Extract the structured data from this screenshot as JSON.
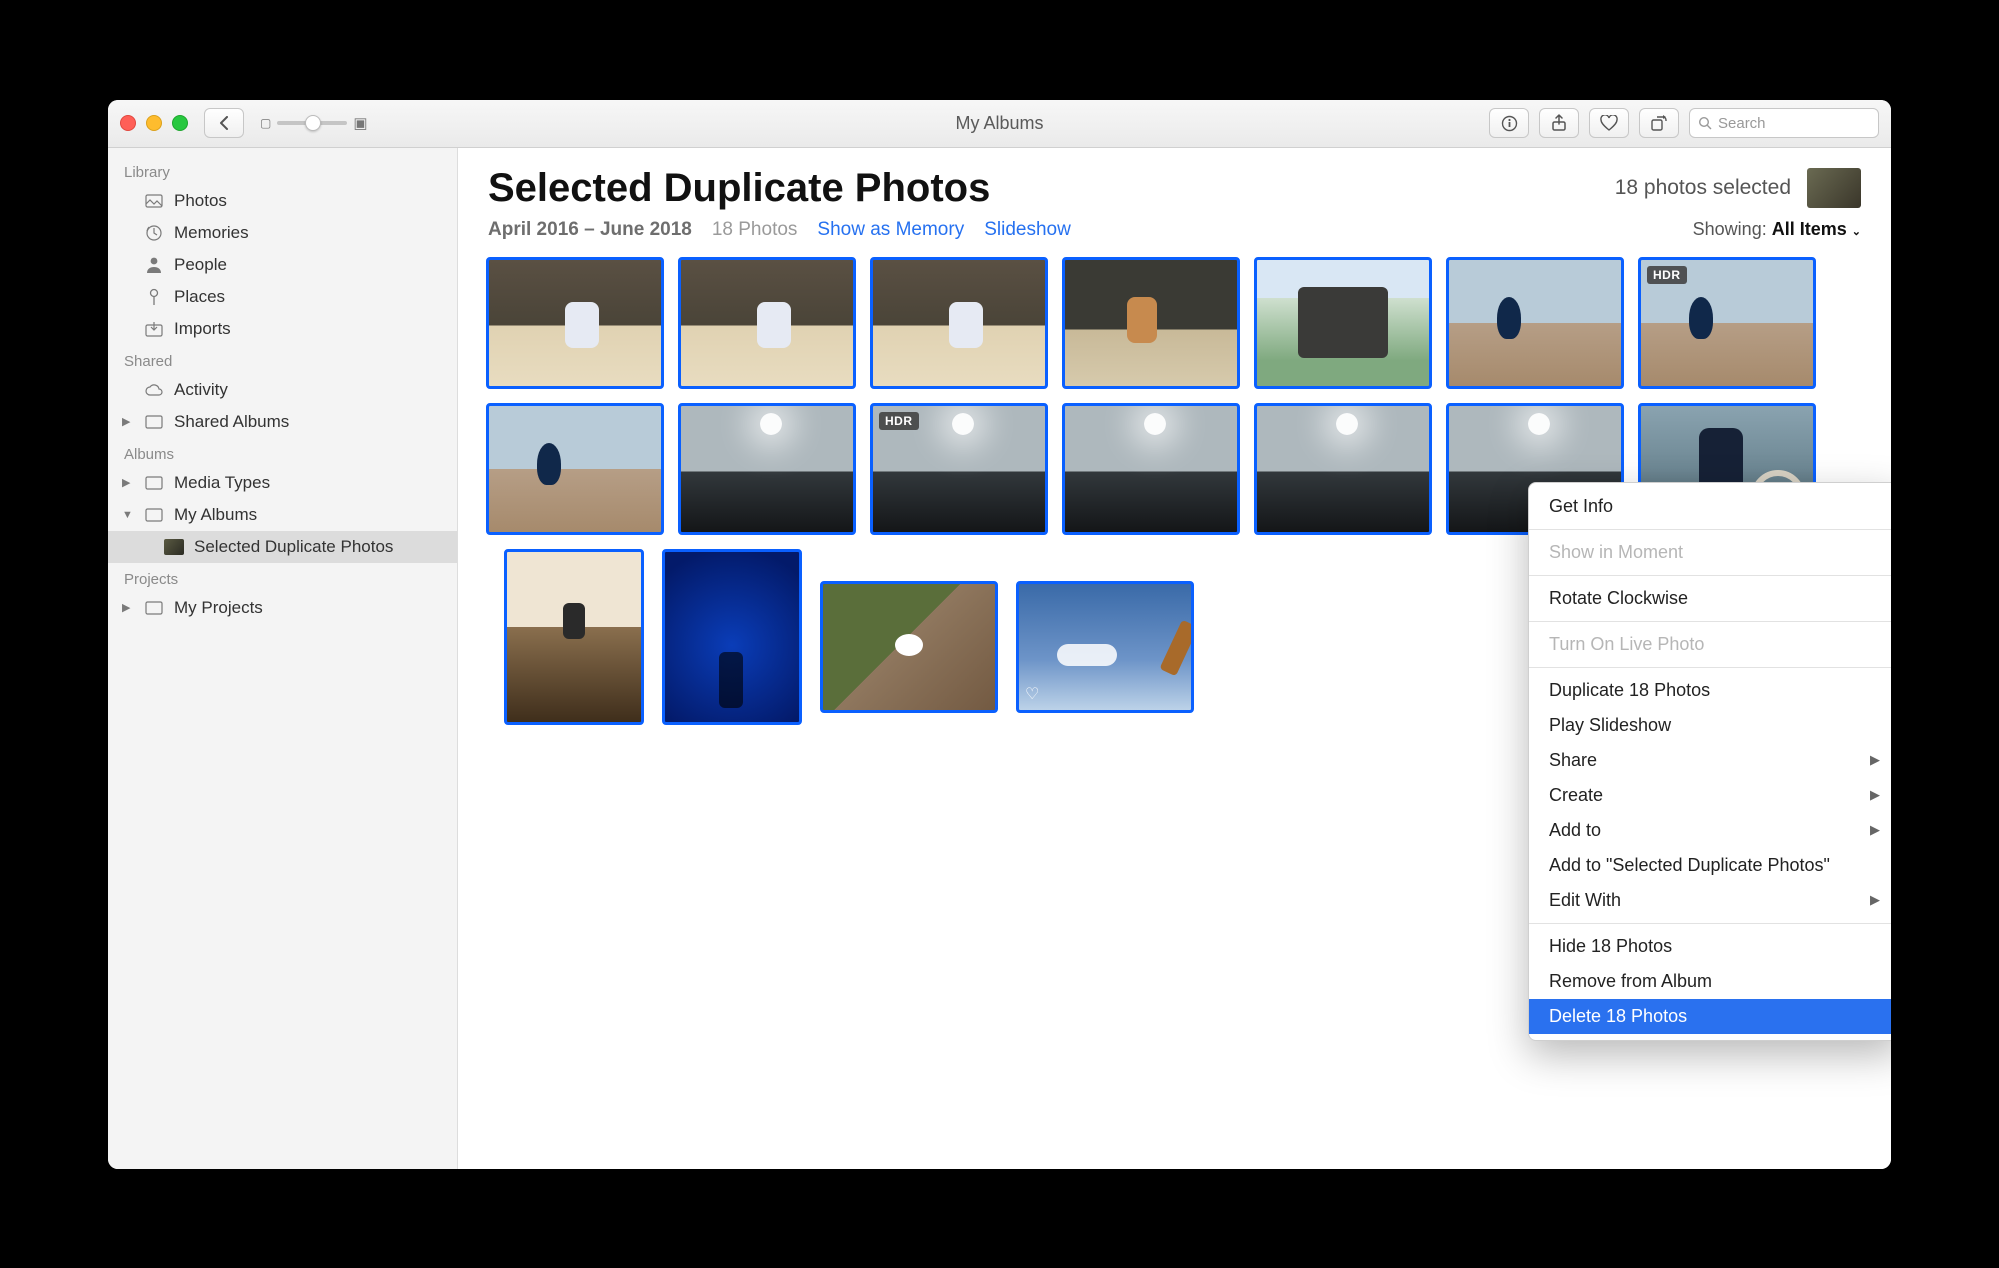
{
  "window_title": "My Albums",
  "search_placeholder": "Search",
  "sidebar": {
    "sections": {
      "library": "Library",
      "shared": "Shared",
      "albums": "Albums",
      "projects": "Projects"
    },
    "library_items": [
      "Photos",
      "Memories",
      "People",
      "Places",
      "Imports"
    ],
    "shared_items": [
      "Activity",
      "Shared Albums"
    ],
    "albums_items": [
      "Media Types",
      "My Albums"
    ],
    "my_albums_children": [
      "Selected Duplicate Photos"
    ],
    "projects_items": [
      "My Projects"
    ]
  },
  "header": {
    "title": "Selected Duplicate Photos",
    "selection": "18 photos selected",
    "date_range": "April 2016 – June 2018",
    "count": "18 Photos",
    "show_as_memory": "Show as Memory",
    "slideshow": "Slideshow",
    "showing_label": "Showing:",
    "showing_value": "All Items"
  },
  "badges": {
    "hdr": "HDR"
  },
  "context_menu": {
    "get_info": "Get Info",
    "show_in_moment": "Show in Moment",
    "rotate": "Rotate Clockwise",
    "live_photo": "Turn On Live Photo",
    "duplicate": "Duplicate 18 Photos",
    "play_slideshow": "Play Slideshow",
    "share": "Share",
    "create": "Create",
    "add_to": "Add to",
    "add_to_album": "Add to \"Selected Duplicate Photos\"",
    "edit_with": "Edit With",
    "hide": "Hide 18 Photos",
    "remove": "Remove from Album",
    "delete": "Delete 18 Photos"
  }
}
